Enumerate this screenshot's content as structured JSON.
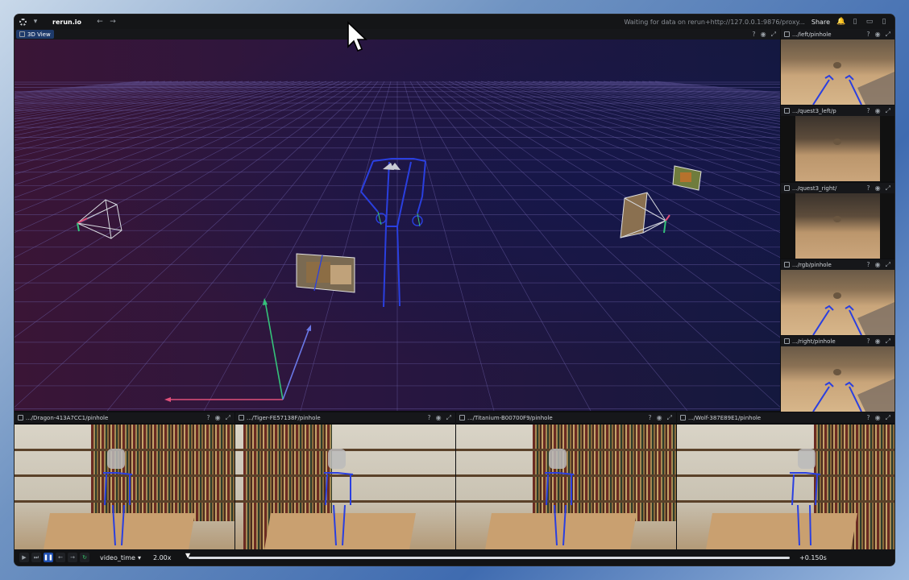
{
  "app": {
    "brand": "rerun.io",
    "status": "Waiting for data on rerun+http://127.0.0.1:9876/proxy...",
    "share_label": "Share"
  },
  "view3d": {
    "tab_label": "3D View"
  },
  "right_panels": [
    {
      "label": ".../left/pinhole"
    },
    {
      "label": ".../quest3_left/p"
    },
    {
      "label": ".../quest3_right/"
    },
    {
      "label": ".../rgb/pinhole"
    },
    {
      "label": ".../right/pinhole"
    }
  ],
  "bottom_panels": [
    {
      "label": ".../Dragon-413A7CC1/pinhole"
    },
    {
      "label": ".../Tiger-FE57138F/pinhole"
    },
    {
      "label": ".../Titanium-B00700F9/pinhole"
    },
    {
      "label": ".../Wolf-387E89E1/pinhole"
    }
  ],
  "timeline": {
    "timeline_name": "video_time",
    "speed": "2.00x",
    "time_value": "+0.150s"
  },
  "icons": {
    "help": "?",
    "eye": "👁",
    "expand": "⤢"
  },
  "colors": {
    "accent": "#1f4fb0",
    "skeleton": "#2a3fe0",
    "axis_x": "#e0507a",
    "axis_y": "#35c27a",
    "axis_z": "#6a78e6"
  }
}
